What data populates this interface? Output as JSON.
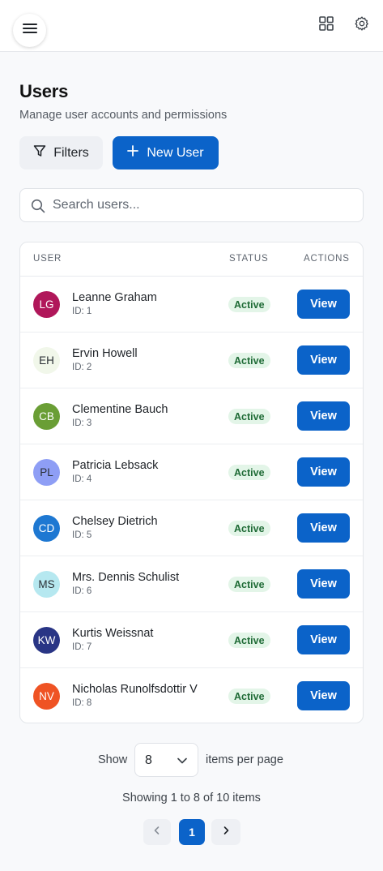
{
  "header": {
    "menu_icon": "hamburger-menu-icon",
    "right_icons": [
      "grid-icon",
      "gear-icon"
    ]
  },
  "page": {
    "title": "Users",
    "subtitle": "Manage user accounts and permissions"
  },
  "toolbar": {
    "filters_label": "Filters",
    "new_user_label": "New User"
  },
  "search": {
    "placeholder": "Search users...",
    "value": ""
  },
  "table": {
    "columns": [
      "USER",
      "STATUS",
      "ACTIONS"
    ],
    "rows": [
      {
        "initials": "LG",
        "name": "Leanne Graham",
        "id": "ID: 1",
        "status": "Active",
        "action": "View",
        "avatar_bg": "#b0175a",
        "avatar_fg": "#ffffff"
      },
      {
        "initials": "EH",
        "name": "Ervin Howell",
        "id": "ID: 2",
        "status": "Active",
        "action": "View",
        "avatar_bg": "#f1f7ea",
        "avatar_fg": "#2a2f35"
      },
      {
        "initials": "CB",
        "name": "Clementine Bauch",
        "id": "ID: 3",
        "status": "Active",
        "action": "View",
        "avatar_bg": "#6a9e35",
        "avatar_fg": "#ffffff"
      },
      {
        "initials": "PL",
        "name": "Patricia Lebsack",
        "id": "ID: 4",
        "status": "Active",
        "action": "View",
        "avatar_bg": "#8e9ef5",
        "avatar_fg": "#2a2f35"
      },
      {
        "initials": "CD",
        "name": "Chelsey Dietrich",
        "id": "ID: 5",
        "status": "Active",
        "action": "View",
        "avatar_bg": "#1e78d2",
        "avatar_fg": "#ffffff"
      },
      {
        "initials": "MS",
        "name": "Mrs. Dennis Schulist",
        "id": "ID: 6",
        "status": "Active",
        "action": "View",
        "avatar_bg": "#b6e8f0",
        "avatar_fg": "#2a2f35"
      },
      {
        "initials": "KW",
        "name": "Kurtis Weissnat",
        "id": "ID: 7",
        "status": "Active",
        "action": "View",
        "avatar_bg": "#293585",
        "avatar_fg": "#ffffff"
      },
      {
        "initials": "NV",
        "name": "Nicholas Runolfsdottir V",
        "id": "ID: 8",
        "status": "Active",
        "action": "View",
        "avatar_bg": "#ef5324",
        "avatar_fg": "#ffffff"
      }
    ]
  },
  "pagination": {
    "show_label": "Show",
    "page_size": "8",
    "per_page_label": "items per page",
    "summary": "Showing 1 to 8 of 10 items",
    "current_page": "1"
  },
  "colors": {
    "primary": "#0b63c9",
    "status_active_bg": "#e3f5e8",
    "status_active_fg": "#1f6b36"
  }
}
